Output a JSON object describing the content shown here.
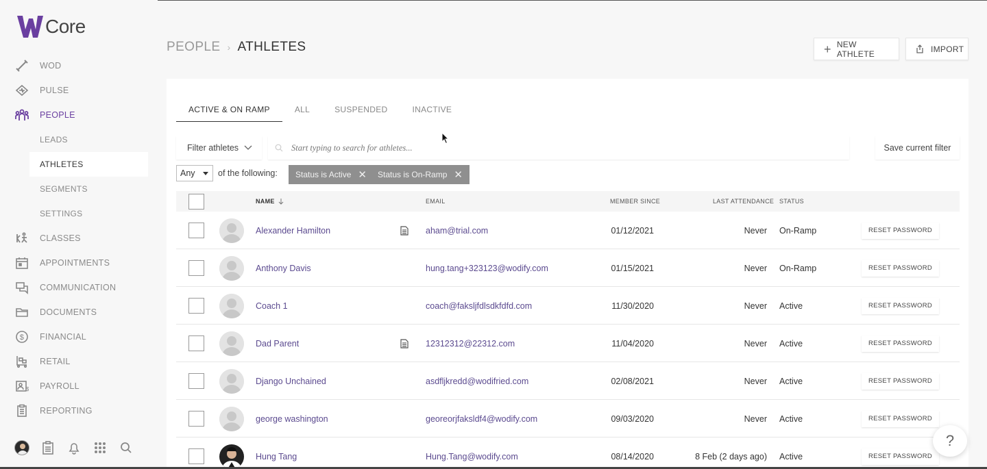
{
  "app": {
    "logo_text": "Core",
    "accent_color": "#6a3fa0",
    "link_color": "#5b4a8f"
  },
  "sidebar": {
    "items": [
      {
        "label": "WOD",
        "icon": "dumbbell-icon"
      },
      {
        "label": "PULSE",
        "icon": "pulse-icon"
      },
      {
        "label": "PEOPLE",
        "icon": "people-icon"
      },
      {
        "label": "CLASSES",
        "icon": "classes-icon"
      },
      {
        "label": "APPOINTMENTS",
        "icon": "calendar-icon"
      },
      {
        "label": "COMMUNICATION",
        "icon": "chat-icon"
      },
      {
        "label": "DOCUMENTS",
        "icon": "folder-icon"
      },
      {
        "label": "FINANCIAL",
        "icon": "dollar-icon"
      },
      {
        "label": "RETAIL",
        "icon": "cart-icon"
      },
      {
        "label": "PAYROLL",
        "icon": "payroll-icon"
      },
      {
        "label": "REPORTING",
        "icon": "report-icon"
      }
    ],
    "people_sub": [
      "LEADS",
      "ATHLETES",
      "SEGMENTS",
      "SETTINGS"
    ]
  },
  "header": {
    "breadcrumb_parent": "PEOPLE",
    "breadcrumb_current": "ATHLETES",
    "new_athlete_label": "NEW ATHLETE",
    "import_label": "IMPORT"
  },
  "tabs": [
    "ACTIVE & ON RAMP",
    "ALL",
    "SUSPENDED",
    "INACTIVE"
  ],
  "filter": {
    "filter_label": "Filter athletes",
    "search_placeholder": "Start typing to search for athletes...",
    "save_label": "Save current filter",
    "match_value": "Any",
    "match_suffix": "of the following:",
    "chips": [
      "Status is Active",
      "Status is On-Ramp"
    ]
  },
  "table": {
    "columns": {
      "name": "NAME",
      "email": "EMAIL",
      "member_since": "MEMBER SINCE",
      "last_attendance": "LAST ATTENDANCE",
      "status": "STATUS"
    },
    "reset_label": "RESET PASSWORD",
    "rows": [
      {
        "name": "Alexander Hamilton",
        "has_doc": true,
        "email": "aham@trial.com",
        "member_since": "01/12/2021",
        "last_attendance": "Never",
        "status": "On-Ramp",
        "photo": false
      },
      {
        "name": "Anthony Davis",
        "has_doc": false,
        "email": "hung.tang+323123@wodify.com",
        "member_since": "01/15/2021",
        "last_attendance": "Never",
        "status": "On-Ramp",
        "photo": false
      },
      {
        "name": "Coach 1",
        "has_doc": false,
        "email": "coach@faksljfdlsdkfdfd.com",
        "member_since": "11/30/2020",
        "last_attendance": "Never",
        "status": "Active",
        "photo": false
      },
      {
        "name": "Dad Parent",
        "has_doc": true,
        "email": "12312312@22312.com",
        "member_since": "11/04/2020",
        "last_attendance": "Never",
        "status": "Active",
        "photo": false
      },
      {
        "name": "Django Unchained",
        "has_doc": false,
        "email": "asdfljkredd@wodifried.com",
        "member_since": "02/08/2021",
        "last_attendance": "Never",
        "status": "Active",
        "photo": false
      },
      {
        "name": "george washington",
        "has_doc": false,
        "email": "georeorjfaksldf4@wodify.com",
        "member_since": "09/03/2020",
        "last_attendance": "Never",
        "status": "Active",
        "photo": false
      },
      {
        "name": "Hung Tang",
        "has_doc": false,
        "email": "Hung.Tang@wodify.com",
        "member_since": "08/14/2020",
        "last_attendance": "8 Feb (2 days ago)",
        "status": "Active",
        "photo": true
      }
    ]
  },
  "help_label": "?"
}
